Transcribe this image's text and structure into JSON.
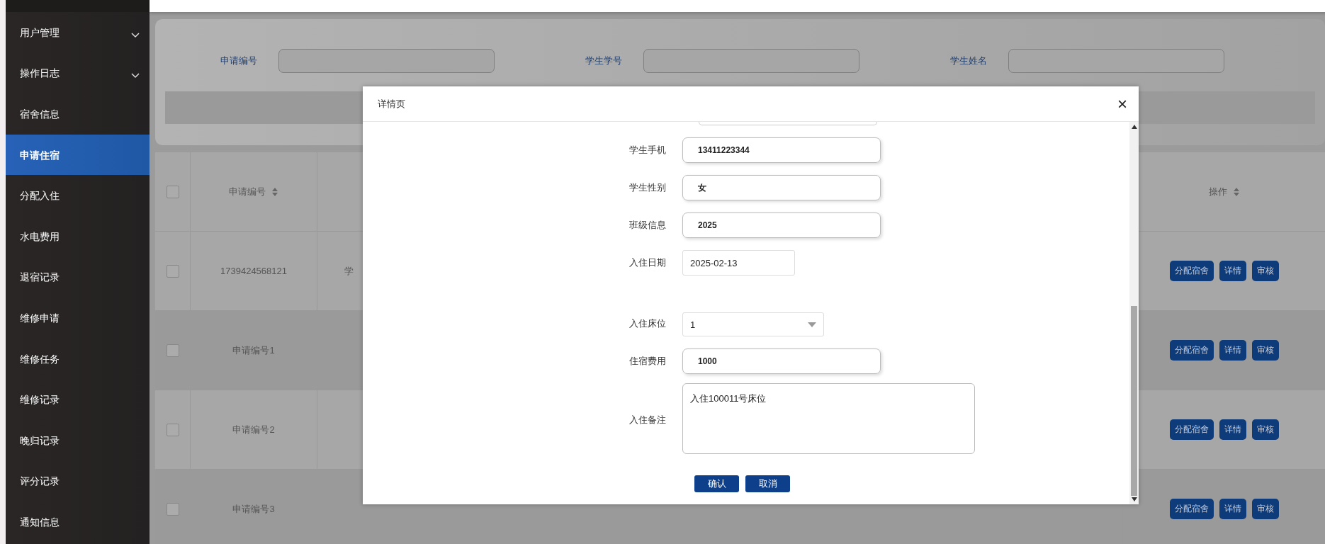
{
  "sidebar": {
    "items": [
      {
        "label": "用户管理",
        "kind": "group",
        "selected": false
      },
      {
        "label": "操作日志",
        "kind": "group",
        "selected": false
      },
      {
        "label": "宿舍信息",
        "kind": "link",
        "selected": false
      },
      {
        "label": "申请住宿",
        "kind": "link",
        "selected": true
      },
      {
        "label": "分配入住",
        "kind": "link",
        "selected": false
      },
      {
        "label": "水电费用",
        "kind": "link",
        "selected": false
      },
      {
        "label": "退宿记录",
        "kind": "link",
        "selected": false
      },
      {
        "label": "维修申请",
        "kind": "link",
        "selected": false
      },
      {
        "label": "维修任务",
        "kind": "link",
        "selected": false
      },
      {
        "label": "维修记录",
        "kind": "link",
        "selected": false
      },
      {
        "label": "晚归记录",
        "kind": "link",
        "selected": false
      },
      {
        "label": "评分记录",
        "kind": "link",
        "selected": false
      },
      {
        "label": "通知信息",
        "kind": "link",
        "selected": false
      }
    ]
  },
  "filters": [
    {
      "label": "申请编号"
    },
    {
      "label": "学生学号"
    },
    {
      "label": "学生姓名"
    }
  ],
  "table": {
    "select_all": {
      "checked": false
    },
    "columns": [
      {
        "label": "申请编号",
        "sortable": true
      },
      {
        "label": "操作",
        "sortable": true
      }
    ],
    "rows": [
      {
        "checked": false,
        "application_no": "1739424568121",
        "column_3": "学",
        "actions": [
          "分配宿舍",
          "详情",
          "审核"
        ]
      },
      {
        "checked": false,
        "application_no": "申请编号1",
        "actions": [
          "分配宿舍",
          "详情",
          "审核"
        ]
      },
      {
        "checked": false,
        "application_no": "申请编号2",
        "actions": [
          "分配宿舍",
          "详情",
          "审核"
        ]
      },
      {
        "checked": false,
        "application_no": "申请编号3",
        "actions": [
          "分配宿舍",
          "详情",
          "审核"
        ]
      }
    ]
  },
  "dialog": {
    "title": "详情页",
    "close": "×",
    "fields": [
      {
        "label": "学生手机",
        "value": "13411223344",
        "kind": "input"
      },
      {
        "label": "学生性别",
        "value": "女",
        "kind": "input"
      },
      {
        "label": "班级信息",
        "value": "2025",
        "kind": "input"
      },
      {
        "label": "入住日期",
        "value": "2025-02-13",
        "kind": "date"
      },
      {
        "label": "入住床位",
        "value": "1",
        "kind": "select"
      },
      {
        "label": "住宿费用",
        "value": "1000",
        "kind": "input"
      },
      {
        "label": "入住备注",
        "value": "入住100011号床位",
        "kind": "textarea"
      }
    ],
    "buttons": [
      "确认",
      "取消"
    ]
  }
}
